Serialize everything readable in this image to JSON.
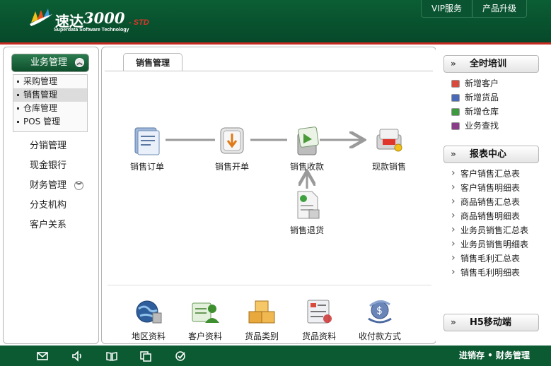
{
  "header": {
    "logo_name": "速达",
    "logo_version": "3000",
    "logo_edition": "- STD",
    "logo_subtitle": "Superdata Software Technology",
    "links": [
      "VIP服务",
      "产品升级"
    ]
  },
  "sidebar": {
    "module_label": "业务管理",
    "sub_items": [
      "采购管理",
      "销售管理",
      "仓库管理",
      "POS 管理"
    ],
    "active_sub": "销售管理",
    "nav_items": [
      "分销管理",
      "现金银行",
      "财务管理",
      "分支机构",
      "客户关系"
    ]
  },
  "main": {
    "tab_label": "销售管理",
    "flow_nodes": {
      "order": "销售订单",
      "invoice": "销售开单",
      "receipt": "销售收款",
      "cash_sale": "现款销售",
      "return": "销售退货"
    },
    "quick_items": [
      "地区资料",
      "客户资料",
      "货品类别",
      "货品资料",
      "收付款方式"
    ]
  },
  "right": {
    "training_title": "全时培训",
    "training_items": [
      "新增客户",
      "新增货品",
      "新增仓库",
      "业务查找"
    ],
    "report_title": "报表中心",
    "report_items": [
      "客户销售汇总表",
      "客户销售明细表",
      "商品销售汇总表",
      "商品销售明细表",
      "业务员销售汇总表",
      "业务员销售明细表",
      "销售毛利汇总表",
      "销售毛利明细表"
    ],
    "mobile_title": "H5移动端"
  },
  "footer": {
    "text": "进销存 • 财务管理",
    "icons": [
      "mail-icon",
      "speaker-icon",
      "book-icon",
      "copy-icon",
      "check-icon"
    ]
  },
  "colors": {
    "header_green": "#0b5e34",
    "accent_red": "#c62b22",
    "footer_green": "#0b5a32"
  }
}
